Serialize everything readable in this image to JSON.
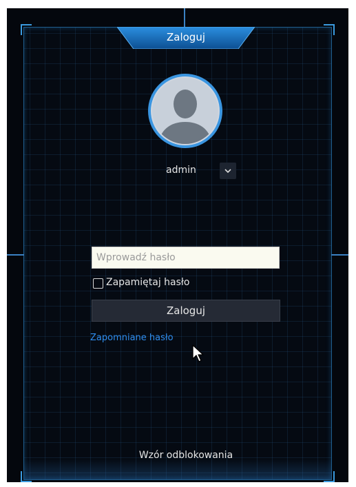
{
  "header": {
    "title": "Zaloguj"
  },
  "user": {
    "username": "admin",
    "avatar_icon": "user-silhouette-icon",
    "dropdown_icon": "chevron-down-icon"
  },
  "form": {
    "password_placeholder": "Wprowadź hasło",
    "password_value": "",
    "remember_label": "Zapamiętaj hasło",
    "remember_checked": false,
    "login_button": "Zaloguj",
    "forgot_link": "Zapomniane hasło"
  },
  "footer": {
    "unlock_pattern": "Wzór odblokowania"
  },
  "colors": {
    "background": "#04070d",
    "accent": "#1e7fd0",
    "link": "#2f8ef0",
    "input_bg": "#fafaf0",
    "button_bg": "#252a35"
  }
}
